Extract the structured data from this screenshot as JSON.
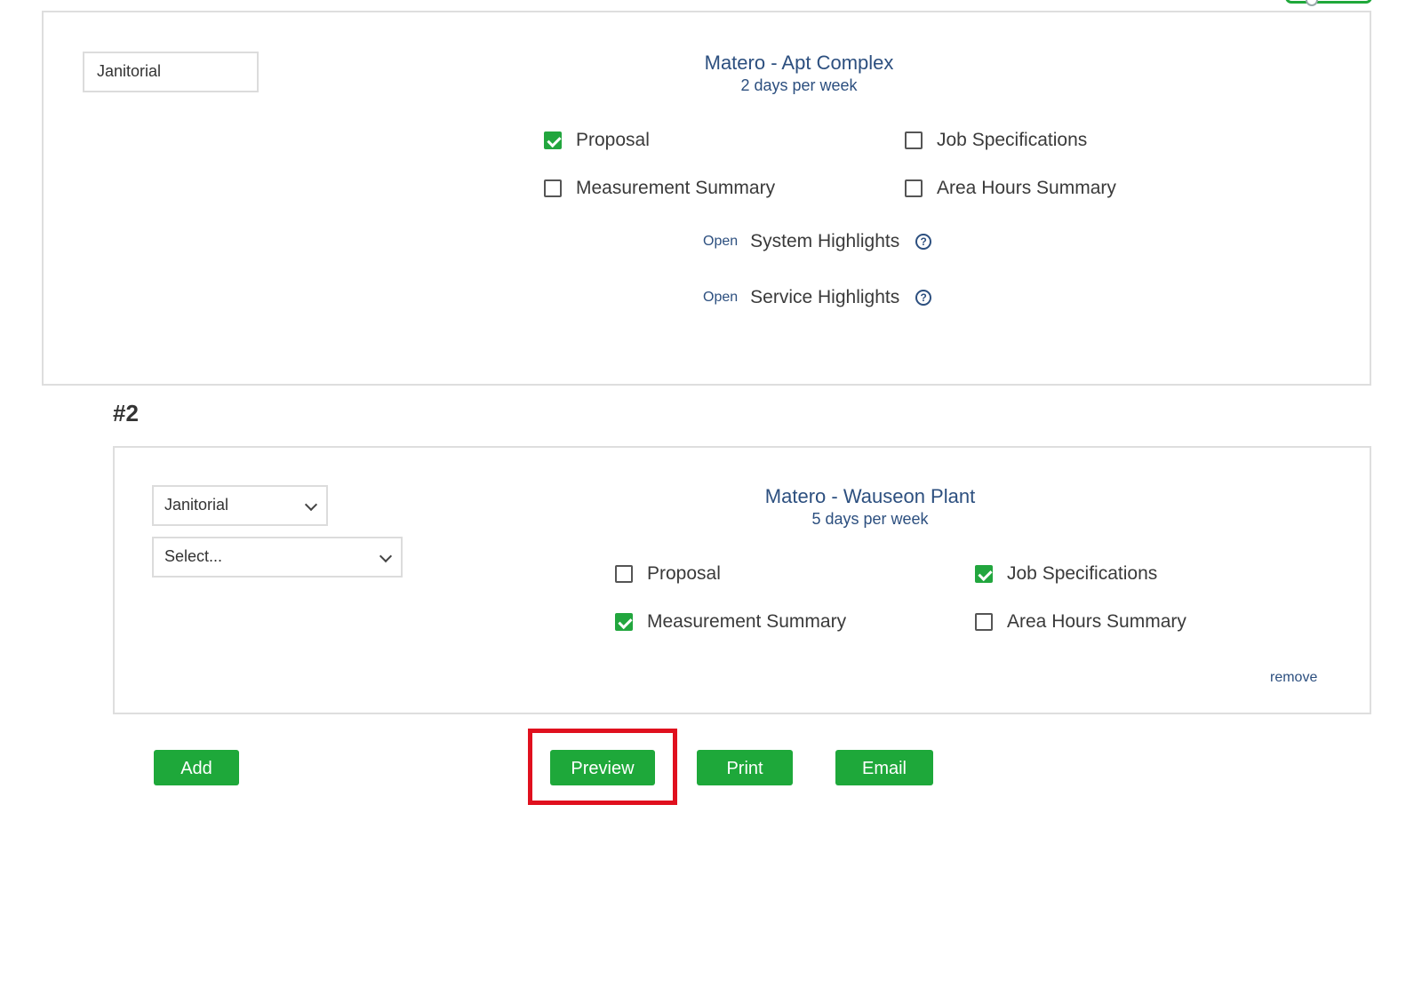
{
  "sections": [
    {
      "service_type": "Janitorial",
      "site_name": "Matero - Apt Complex",
      "frequency": "2 days per week",
      "options": [
        {
          "label": "Proposal",
          "checked": true
        },
        {
          "label": "Job Specifications",
          "checked": false
        },
        {
          "label": "Measurement Summary",
          "checked": false
        },
        {
          "label": "Area Hours Summary",
          "checked": false
        }
      ],
      "highlights": [
        {
          "link": "Open",
          "label": "System Highlights",
          "help_icon": "question-circle-icon"
        },
        {
          "link": "Open",
          "label": "Service Highlights",
          "help_icon": "question-circle-icon"
        }
      ]
    },
    {
      "number": "#2",
      "service_type": "Janitorial",
      "secondary_select": "Select...",
      "site_name": "Matero - Wauseon Plant",
      "frequency": "5 days per week",
      "options": [
        {
          "label": "Proposal",
          "checked": false
        },
        {
          "label": "Job Specifications",
          "checked": true
        },
        {
          "label": "Measurement Summary",
          "checked": true
        },
        {
          "label": "Area Hours Summary",
          "checked": false
        }
      ],
      "remove_label": "remove"
    }
  ],
  "actions": {
    "add": "Add",
    "preview": "Preview",
    "print": "Print",
    "email": "Email"
  },
  "colors": {
    "accent_green": "#1ea83a",
    "link_blue": "#2c4f7f",
    "highlight_red": "#e0101e"
  }
}
